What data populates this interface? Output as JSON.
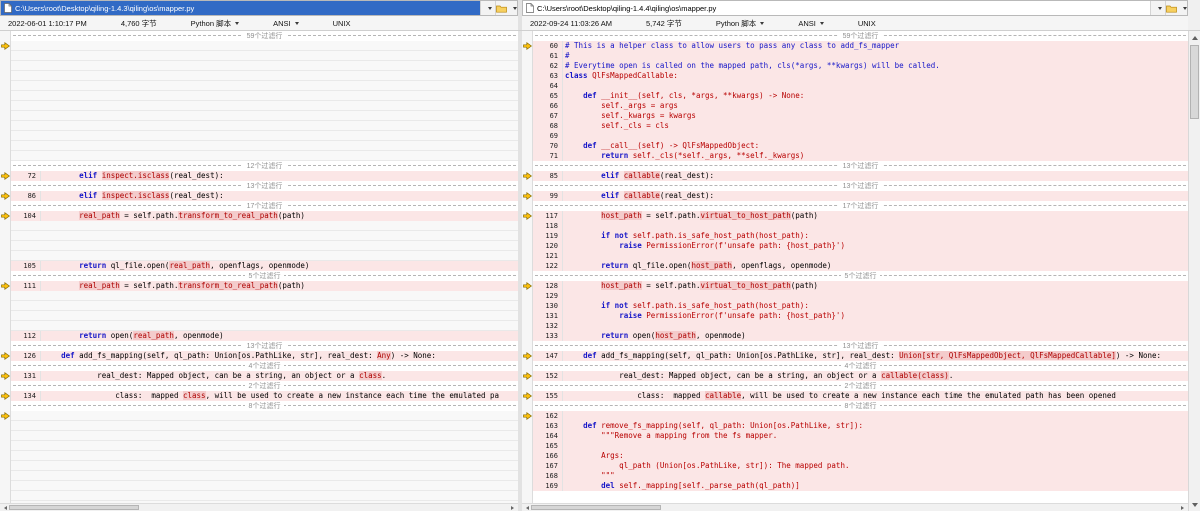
{
  "left_header": {
    "path": "C:\\Users\\root\\Desktop\\qiling-1.4.3\\qiling\\os\\mapper.py",
    "active": true
  },
  "right_header": {
    "path": "C:\\Users\\root\\Desktop\\qiling-1.4.4\\qiling\\os\\mapper.py",
    "active": false
  },
  "left_info": {
    "modified": "2022-06-01 1:10:17 PM",
    "size": "4,760 字节",
    "file_type": "Python 脚本",
    "encoding": "ANSI",
    "eol": "UNIX"
  },
  "right_info": {
    "modified": "2022-09-24 11:03:26 AM",
    "size": "5,742 字节",
    "file_type": "Python 脚本",
    "encoding": "ANSI",
    "eol": "UNIX"
  },
  "colors": {
    "active_header_bg": "#316ac5",
    "diff_line_bg": "#fbe6e6",
    "word_diff_bg": "#f4cbcb",
    "changed_text": "#b80000",
    "keyword_text": "#1616c8",
    "comment_text": "#1616c8",
    "separator_text": "#8f8f8f",
    "marker_yellow": "#ffc20e"
  },
  "icons": {
    "document": "document-icon",
    "folder": "folder-open-icon",
    "chevron": "chevron-down-icon",
    "marker": "diff-change-arrow-icon"
  },
  "rows": [
    {
      "l": {
        "t": "sep",
        "x": "59个过滤行"
      },
      "r": {
        "t": "sep",
        "x": "59个过滤行"
      }
    },
    {
      "l": {
        "t": "gap",
        "m": 1
      },
      "r": {
        "t": "ln",
        "n": 60,
        "d": 1,
        "m": 1,
        "s": [
          [
            "# This is a helper class to allow users to pass any class to add_fs_mapper",
            "c"
          ]
        ]
      }
    },
    {
      "l": {
        "t": "gap"
      },
      "r": {
        "t": "ln",
        "n": 61,
        "d": 1,
        "s": [
          [
            "#",
            "c"
          ]
        ]
      }
    },
    {
      "l": {
        "t": "gap"
      },
      "r": {
        "t": "ln",
        "n": 62,
        "d": 1,
        "s": [
          [
            "# Everytime open is called on the mapped path, cls(*args, **kwargs) will be called.",
            "c"
          ]
        ]
      }
    },
    {
      "l": {
        "t": "gap"
      },
      "r": {
        "t": "ln",
        "n": 63,
        "d": 1,
        "s": [
          [
            "class ",
            "b"
          ],
          [
            "QlFsMappedCallable:",
            "r"
          ]
        ]
      }
    },
    {
      "l": {
        "t": "gap"
      },
      "r": {
        "t": "ln",
        "n": 64,
        "d": 1,
        "s": []
      }
    },
    {
      "l": {
        "t": "gap"
      },
      "r": {
        "t": "ln",
        "n": 65,
        "d": 1,
        "s": [
          [
            "    ",
            "n"
          ],
          [
            "def ",
            "b"
          ],
          [
            "__init__(self, cls, *args, **kwargs) -> None:",
            "r"
          ]
        ]
      }
    },
    {
      "l": {
        "t": "gap"
      },
      "r": {
        "t": "ln",
        "n": 66,
        "d": 1,
        "s": [
          [
            "        self._args = args",
            "r"
          ]
        ]
      }
    },
    {
      "l": {
        "t": "gap"
      },
      "r": {
        "t": "ln",
        "n": 67,
        "d": 1,
        "s": [
          [
            "        self._kwargs = kwargs",
            "r"
          ]
        ]
      }
    },
    {
      "l": {
        "t": "gap"
      },
      "r": {
        "t": "ln",
        "n": 68,
        "d": 1,
        "s": [
          [
            "        self._cls = cls",
            "r"
          ]
        ]
      }
    },
    {
      "l": {
        "t": "gap"
      },
      "r": {
        "t": "ln",
        "n": 69,
        "d": 1,
        "s": []
      }
    },
    {
      "l": {
        "t": "gap"
      },
      "r": {
        "t": "ln",
        "n": 70,
        "d": 1,
        "s": [
          [
            "    ",
            "n"
          ],
          [
            "def ",
            "b"
          ],
          [
            "__call__(self) -> QlFsMappedObject:",
            "r"
          ]
        ]
      }
    },
    {
      "l": {
        "t": "gap"
      },
      "r": {
        "t": "ln",
        "n": 71,
        "d": 1,
        "s": [
          [
            "        ",
            "n"
          ],
          [
            "return ",
            "b"
          ],
          [
            "self._cls(*self._args, **self._kwargs)",
            "r"
          ]
        ]
      }
    },
    {
      "l": {
        "t": "sep",
        "x": "12个过滤行"
      },
      "r": {
        "t": "sep",
        "x": "13个过滤行"
      }
    },
    {
      "l": {
        "t": "ln",
        "n": 72,
        "d": 1,
        "m": 1,
        "s": [
          [
            "        ",
            "n"
          ],
          [
            "elif ",
            "b"
          ],
          [
            "inspect.isclass",
            "w"
          ],
          [
            "(real_dest):",
            "n"
          ]
        ]
      },
      "r": {
        "t": "ln",
        "n": 85,
        "d": 1,
        "m": 1,
        "s": [
          [
            "        ",
            "n"
          ],
          [
            "elif ",
            "b"
          ],
          [
            "callable",
            "w"
          ],
          [
            "(real_dest):",
            "n"
          ]
        ]
      }
    },
    {
      "l": {
        "t": "sep",
        "x": "13个过滤行"
      },
      "r": {
        "t": "sep",
        "x": "13个过滤行"
      }
    },
    {
      "l": {
        "t": "ln",
        "n": 86,
        "d": 1,
        "m": 1,
        "s": [
          [
            "        ",
            "n"
          ],
          [
            "elif ",
            "b"
          ],
          [
            "inspect.isclass",
            "w"
          ],
          [
            "(real_dest):",
            "n"
          ]
        ]
      },
      "r": {
        "t": "ln",
        "n": 99,
        "d": 1,
        "m": 1,
        "s": [
          [
            "        ",
            "n"
          ],
          [
            "elif ",
            "b"
          ],
          [
            "callable",
            "w"
          ],
          [
            "(real_dest):",
            "n"
          ]
        ]
      }
    },
    {
      "l": {
        "t": "sep",
        "x": "17个过滤行"
      },
      "r": {
        "t": "sep",
        "x": "17个过滤行"
      }
    },
    {
      "l": {
        "t": "ln",
        "n": 104,
        "d": 1,
        "m": 1,
        "s": [
          [
            "        ",
            "n"
          ],
          [
            "real_path",
            "w"
          ],
          [
            " = self.path.",
            "n"
          ],
          [
            "transform_to_real_path",
            "w"
          ],
          [
            "(path)",
            "n"
          ]
        ]
      },
      "r": {
        "t": "ln",
        "n": 117,
        "d": 1,
        "m": 1,
        "s": [
          [
            "        ",
            "n"
          ],
          [
            "host_path",
            "w"
          ],
          [
            " = self.path.",
            "n"
          ],
          [
            "virtual_to_host_path",
            "w"
          ],
          [
            "(path)",
            "n"
          ]
        ]
      }
    },
    {
      "l": {
        "t": "gap"
      },
      "r": {
        "t": "ln",
        "n": 118,
        "d": 1,
        "s": []
      }
    },
    {
      "l": {
        "t": "gap"
      },
      "r": {
        "t": "ln",
        "n": 119,
        "d": 1,
        "s": [
          [
            "        ",
            "n"
          ],
          [
            "if not ",
            "b"
          ],
          [
            "self.path.is_safe_host_path(host_path):",
            "r"
          ]
        ]
      }
    },
    {
      "l": {
        "t": "gap"
      },
      "r": {
        "t": "ln",
        "n": 120,
        "d": 1,
        "s": [
          [
            "            ",
            "n"
          ],
          [
            "raise ",
            "b"
          ],
          [
            "PermissionError(f'unsafe path: {host_path}')",
            "r"
          ]
        ]
      }
    },
    {
      "l": {
        "t": "gap"
      },
      "r": {
        "t": "ln",
        "n": 121,
        "d": 1,
        "s": []
      }
    },
    {
      "l": {
        "t": "ln",
        "n": 105,
        "d": 1,
        "s": [
          [
            "        ",
            "n"
          ],
          [
            "return ",
            "b"
          ],
          [
            "ql_file.open(",
            "n"
          ],
          [
            "real_path",
            "w"
          ],
          [
            ", openflags, openmode)",
            "n"
          ]
        ]
      },
      "r": {
        "t": "ln",
        "n": 122,
        "d": 1,
        "s": [
          [
            "        ",
            "n"
          ],
          [
            "return ",
            "b"
          ],
          [
            "ql_file.open(",
            "n"
          ],
          [
            "host_path",
            "w"
          ],
          [
            ", openflags, openmode)",
            "n"
          ]
        ]
      }
    },
    {
      "l": {
        "t": "sep",
        "x": "5个过滤行"
      },
      "r": {
        "t": "sep",
        "x": "5个过滤行"
      }
    },
    {
      "l": {
        "t": "ln",
        "n": 111,
        "d": 1,
        "m": 1,
        "s": [
          [
            "        ",
            "n"
          ],
          [
            "real_path",
            "w"
          ],
          [
            " = self.path.",
            "n"
          ],
          [
            "transform_to_real_path",
            "w"
          ],
          [
            "(path)",
            "n"
          ]
        ]
      },
      "r": {
        "t": "ln",
        "n": 128,
        "d": 1,
        "m": 1,
        "s": [
          [
            "        ",
            "n"
          ],
          [
            "host_path",
            "w"
          ],
          [
            " = self.path.",
            "n"
          ],
          [
            "virtual_to_host_path",
            "w"
          ],
          [
            "(path)",
            "n"
          ]
        ]
      }
    },
    {
      "l": {
        "t": "gap"
      },
      "r": {
        "t": "ln",
        "n": 129,
        "d": 1,
        "s": []
      }
    },
    {
      "l": {
        "t": "gap"
      },
      "r": {
        "t": "ln",
        "n": 130,
        "d": 1,
        "s": [
          [
            "        ",
            "n"
          ],
          [
            "if not ",
            "b"
          ],
          [
            "self.path.is_safe_host_path(host_path):",
            "r"
          ]
        ]
      }
    },
    {
      "l": {
        "t": "gap"
      },
      "r": {
        "t": "ln",
        "n": 131,
        "d": 1,
        "s": [
          [
            "            ",
            "n"
          ],
          [
            "raise ",
            "b"
          ],
          [
            "PermissionError(f'unsafe path: {host_path}')",
            "r"
          ]
        ]
      }
    },
    {
      "l": {
        "t": "gap"
      },
      "r": {
        "t": "ln",
        "n": 132,
        "d": 1,
        "s": []
      }
    },
    {
      "l": {
        "t": "ln",
        "n": 112,
        "d": 1,
        "s": [
          [
            "        ",
            "n"
          ],
          [
            "return ",
            "b"
          ],
          [
            "open(",
            "n"
          ],
          [
            "real_path",
            "w"
          ],
          [
            ", openmode)",
            "n"
          ]
        ]
      },
      "r": {
        "t": "ln",
        "n": 133,
        "d": 1,
        "s": [
          [
            "        ",
            "n"
          ],
          [
            "return ",
            "b"
          ],
          [
            "open(",
            "n"
          ],
          [
            "host_path",
            "w"
          ],
          [
            ", openmode)",
            "n"
          ]
        ]
      }
    },
    {
      "l": {
        "t": "sep",
        "x": "13个过滤行"
      },
      "r": {
        "t": "sep",
        "x": "13个过滤行"
      }
    },
    {
      "l": {
        "t": "ln",
        "n": 126,
        "d": 1,
        "m": 1,
        "s": [
          [
            "    ",
            "n"
          ],
          [
            "def ",
            "b"
          ],
          [
            "add_fs_mapping(self, ql_path: Union[os.PathLike, str], real_dest: ",
            "n"
          ],
          [
            "Any",
            "w"
          ],
          [
            ") -> None:",
            "n"
          ]
        ]
      },
      "r": {
        "t": "ln",
        "n": 147,
        "d": 1,
        "m": 1,
        "s": [
          [
            "    ",
            "n"
          ],
          [
            "def ",
            "b"
          ],
          [
            "add_fs_mapping(self, ql_path: Union[os.PathLike, str], real_dest: ",
            "n"
          ],
          [
            "Union[str, QlFsMappedObject, QlFsMappedCallable]",
            "w"
          ],
          [
            ") -> None:",
            "n"
          ]
        ]
      }
    },
    {
      "l": {
        "t": "sep",
        "x": "4个过滤行"
      },
      "r": {
        "t": "sep",
        "x": "4个过滤行"
      }
    },
    {
      "l": {
        "t": "ln",
        "n": 131,
        "d": 1,
        "m": 1,
        "s": [
          [
            "            real_dest: Mapped object, can be a string, an object or a ",
            "n"
          ],
          [
            "class",
            "w"
          ],
          [
            ".",
            "n"
          ]
        ]
      },
      "r": {
        "t": "ln",
        "n": 152,
        "d": 1,
        "m": 1,
        "s": [
          [
            "            real_dest: Mapped object, can be a string, an object or a ",
            "n"
          ],
          [
            "callable(class)",
            "w"
          ],
          [
            ".",
            "n"
          ]
        ]
      }
    },
    {
      "l": {
        "t": "sep",
        "x": "2个过滤行"
      },
      "r": {
        "t": "sep",
        "x": "2个过滤行"
      }
    },
    {
      "l": {
        "t": "ln",
        "n": 134,
        "d": 1,
        "m": 1,
        "s": [
          [
            "                class:  mapped ",
            "n"
          ],
          [
            "class",
            "w"
          ],
          [
            ", will be used to create a new instance each time the emulated pa",
            "n"
          ]
        ]
      },
      "r": {
        "t": "ln",
        "n": 155,
        "d": 1,
        "m": 1,
        "s": [
          [
            "                class:  mapped ",
            "n"
          ],
          [
            "callable",
            "w"
          ],
          [
            ", will be used to create a new instance each time the emulated path has been opened",
            "n"
          ]
        ]
      }
    },
    {
      "l": {
        "t": "sep",
        "x": "8个过滤行"
      },
      "r": {
        "t": "sep",
        "x": "8个过滤行"
      }
    },
    {
      "l": {
        "t": "gap",
        "m": 1
      },
      "r": {
        "t": "ln",
        "n": 162,
        "d": 1,
        "m": 1,
        "s": []
      }
    },
    {
      "l": {
        "t": "gap"
      },
      "r": {
        "t": "ln",
        "n": 163,
        "d": 1,
        "s": [
          [
            "    ",
            "n"
          ],
          [
            "def ",
            "b"
          ],
          [
            "remove_fs_mapping(self, ql_path: Union[os.PathLike, str]):",
            "r"
          ]
        ]
      }
    },
    {
      "l": {
        "t": "gap"
      },
      "r": {
        "t": "ln",
        "n": 164,
        "d": 1,
        "s": [
          [
            "        \"\"\"Remove a mapping from the fs mapper.",
            "r"
          ]
        ]
      }
    },
    {
      "l": {
        "t": "gap"
      },
      "r": {
        "t": "ln",
        "n": 165,
        "d": 1,
        "s": []
      }
    },
    {
      "l": {
        "t": "gap"
      },
      "r": {
        "t": "ln",
        "n": 166,
        "d": 1,
        "s": [
          [
            "        Args:",
            "r"
          ]
        ]
      }
    },
    {
      "l": {
        "t": "gap"
      },
      "r": {
        "t": "ln",
        "n": 167,
        "d": 1,
        "s": [
          [
            "            ql_path (Union[os.PathLike, str]): The mapped path.",
            "r"
          ]
        ]
      }
    },
    {
      "l": {
        "t": "gap"
      },
      "r": {
        "t": "ln",
        "n": 168,
        "d": 1,
        "s": [
          [
            "        \"\"\"",
            "r"
          ]
        ]
      }
    },
    {
      "l": {
        "t": "gap"
      },
      "r": {
        "t": "ln",
        "n": 169,
        "d": 1,
        "s": [
          [
            "        ",
            "n"
          ],
          [
            "del ",
            "b"
          ],
          [
            "self._mapping[self._parse_path(ql_path)]",
            "r"
          ]
        ]
      }
    }
  ]
}
